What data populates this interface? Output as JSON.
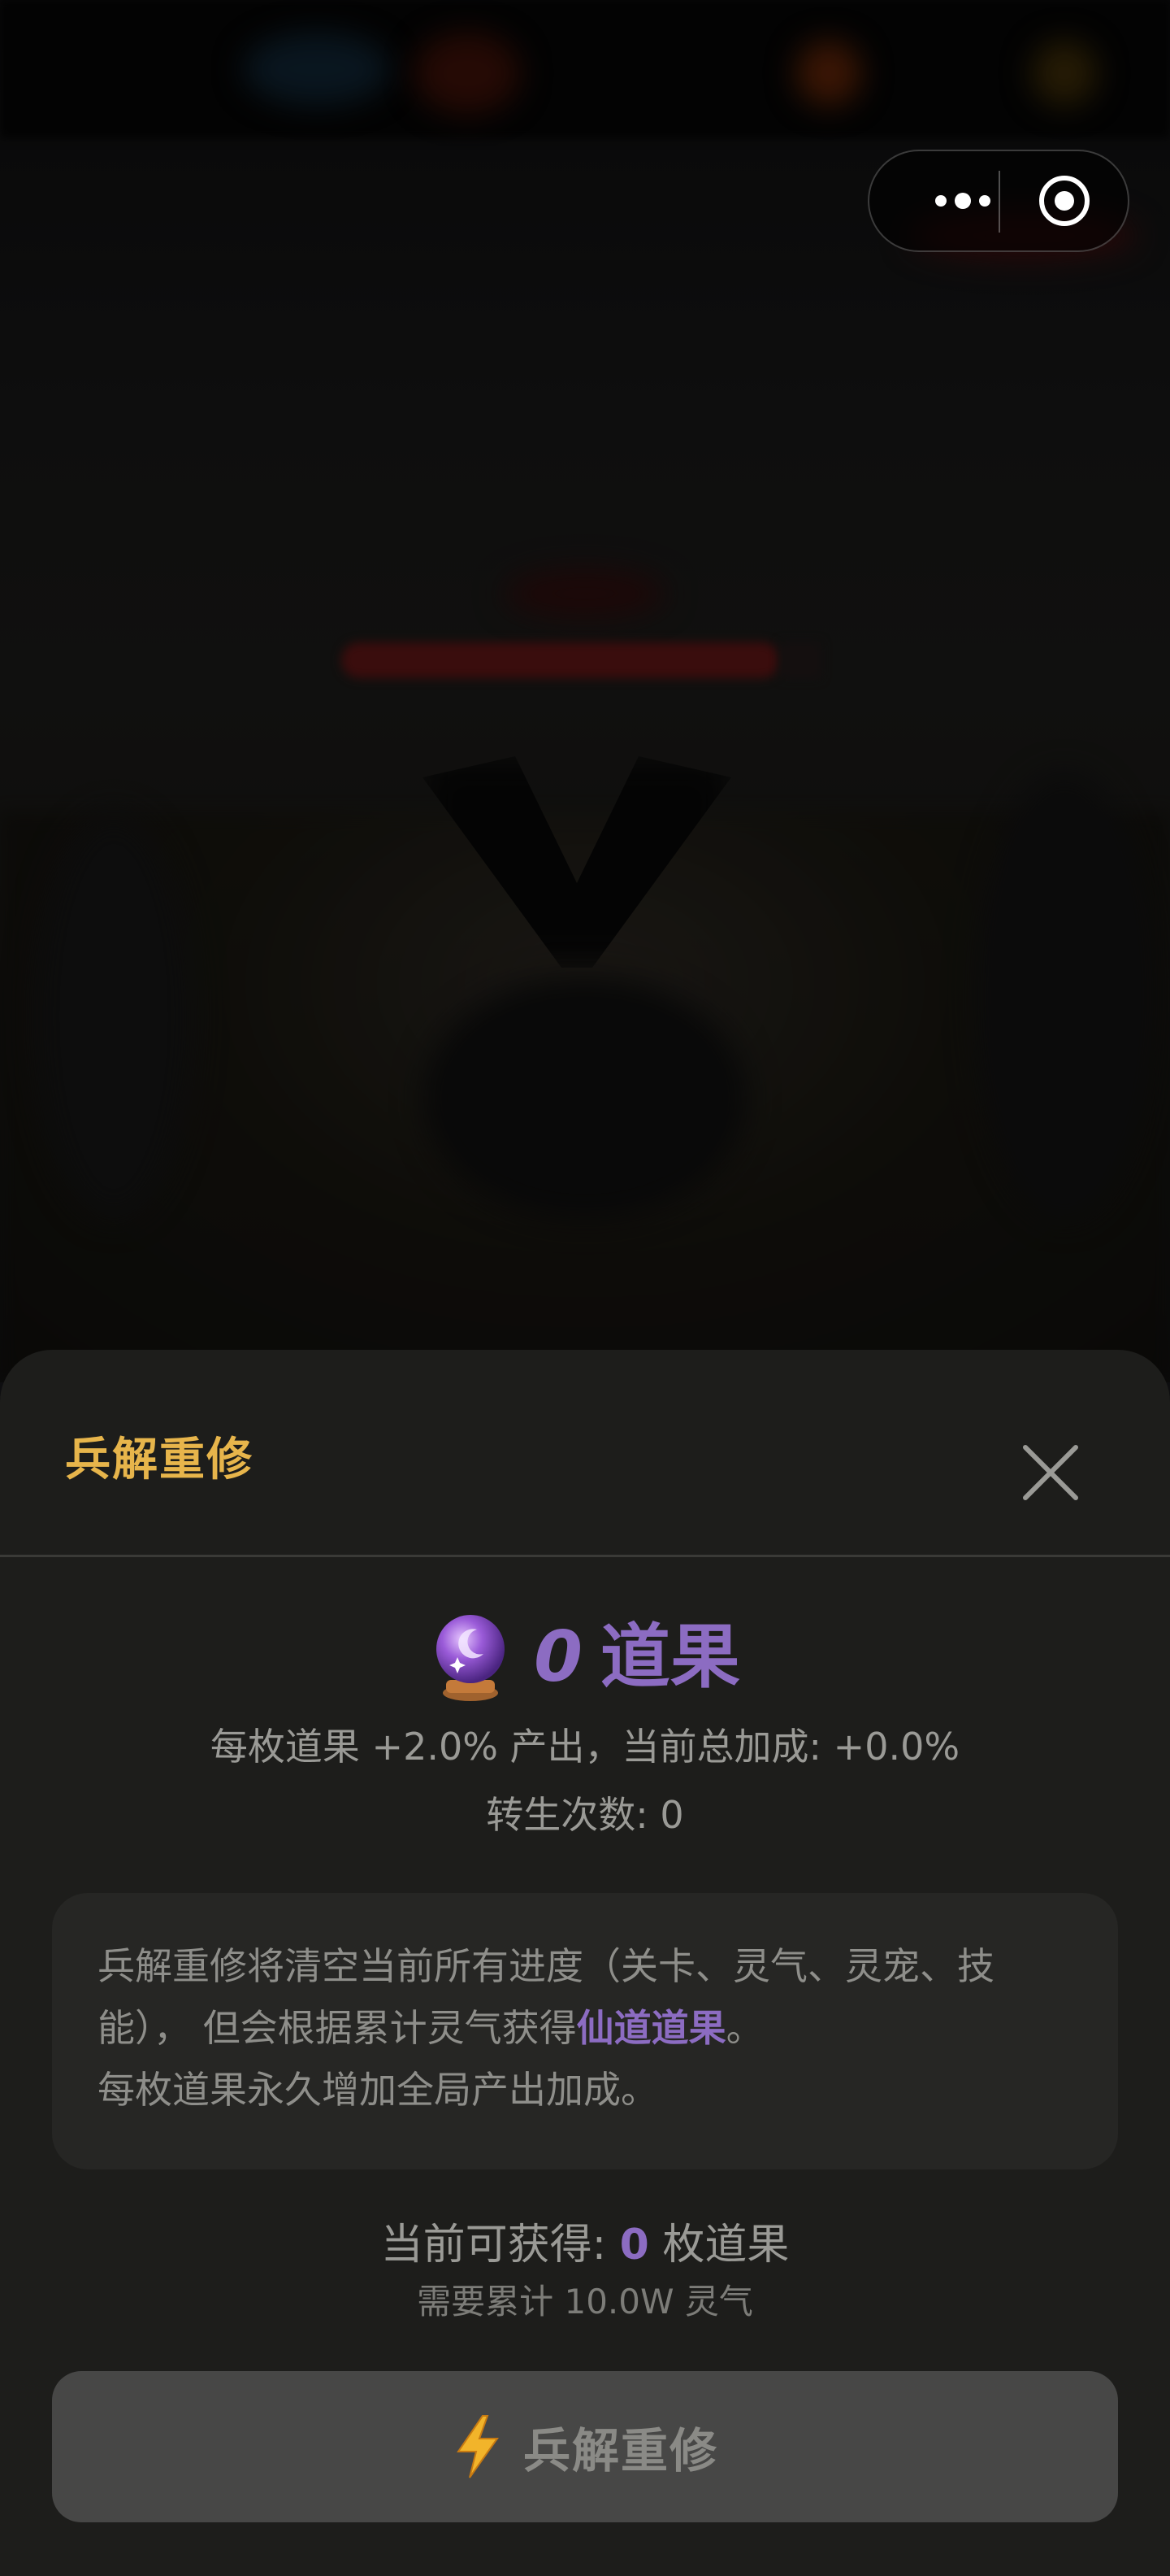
{
  "sheet": {
    "title": "兵解重修",
    "fruit_count": "0",
    "fruit_unit": "道果",
    "bonus_text": "每枚道果 +2.0% 产出，当前总加成: +0.0%",
    "rebirth_text": "转生次数: 0",
    "info": {
      "line1_a": "兵解重修将清空当前所有进度（关卡、灵气、灵宠、技能）， 但会根据累计灵气获得",
      "line1_highlight": "仙道道果",
      "line1_end": "。",
      "line2": "每枚道果永久增加全局产出加成。"
    },
    "gain": {
      "prefix": "当前可获得: ",
      "count": "0",
      "suffix": " 枚道果"
    },
    "need_text": "需要累计 10.0W 灵气",
    "button_label": "兵解重修"
  },
  "icons": {
    "close": "close-icon",
    "crystal": "crystal-ball-icon",
    "bolt": "lightning-bolt-icon",
    "more": "more-dots-icon",
    "target": "target-icon"
  },
  "colors": {
    "title_gold": "#e7b54b",
    "accent_purple": "#8c6cc2",
    "sheet_bg": "#1d1d1b",
    "button_bg": "#474746"
  }
}
